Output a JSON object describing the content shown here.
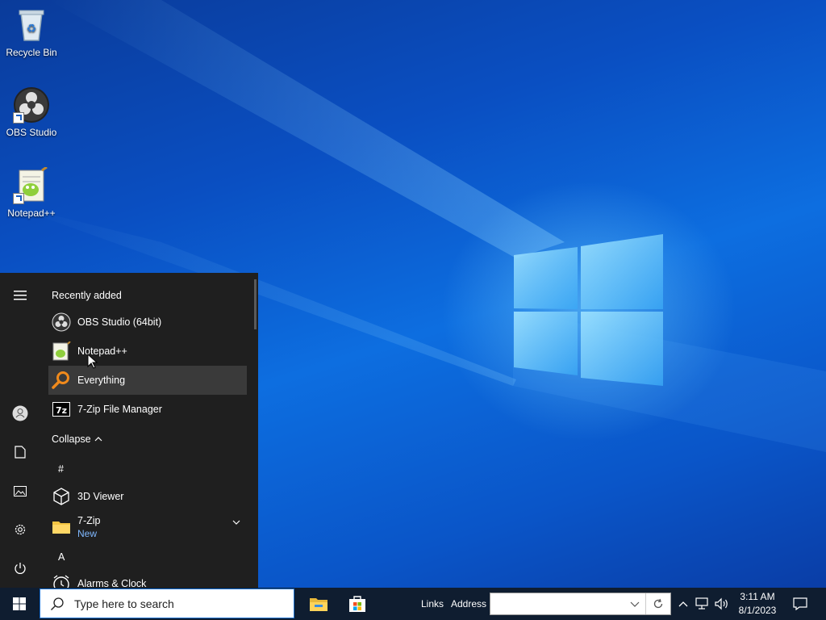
{
  "desktop": {
    "icons": [
      {
        "label": "Recycle Bin",
        "icon": "recycle-bin-icon"
      },
      {
        "label": "OBS Studio",
        "icon": "obs-studio-icon"
      },
      {
        "label": "Notepad++",
        "icon": "notepadpp-icon"
      }
    ]
  },
  "start_menu": {
    "recently_added_heading": "Recently added",
    "recent_apps": [
      {
        "label": "OBS Studio (64bit)",
        "icon": "obs-studio-icon"
      },
      {
        "label": "Notepad++",
        "icon": "notepadpp-icon"
      },
      {
        "label": "Everything",
        "icon": "everything-search-icon"
      },
      {
        "label": "7-Zip File Manager",
        "icon": "seven-zip-icon"
      }
    ],
    "collapse_label": "Collapse",
    "group_hash": "#",
    "group_a": "A",
    "apps": [
      {
        "label": "3D Viewer",
        "icon": "cube-icon"
      },
      {
        "label": "7-Zip",
        "sublabel": "New",
        "icon": "folder-icon"
      },
      {
        "label": "Alarms & Clock",
        "icon": "alarm-clock-icon"
      }
    ],
    "rail_icons": [
      "hamburger-menu-icon",
      "user-icon",
      "document-icon",
      "pictures-icon",
      "settings-icon",
      "power-icon"
    ]
  },
  "taskbar": {
    "search_placeholder": "Type here to search",
    "pinned_apps": [
      "file-explorer-icon",
      "microsoft-store-icon"
    ],
    "links_label": "Links",
    "address_label": "Address",
    "address_value": "",
    "clock_time": "3:11 AM",
    "clock_date": "8/1/2023"
  },
  "colors": {
    "taskbar": "#0f1d30",
    "start_menu": "#1f1f1f",
    "accent": "#1a6fd0"
  }
}
